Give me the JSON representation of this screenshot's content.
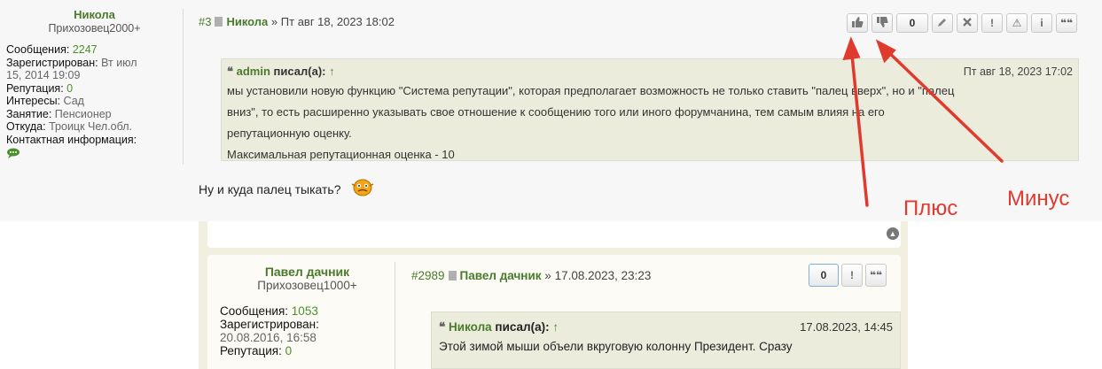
{
  "post1": {
    "profile": {
      "name": "Никола",
      "rank": "Прихозовец2000+",
      "messages_label": "Сообщения:",
      "messages_value": "2247",
      "registered_label": "Зарегистрирован:",
      "registered_value_a": "Вт июл",
      "registered_value_b": "15, 2014 19:09",
      "reputation_label": "Репутация:",
      "reputation_value": "0",
      "interests_label": "Интересы:",
      "interests_value": "Сад",
      "occupation_label": "Занятие:",
      "occupation_value": "Пенсионер",
      "from_label": "Откуда:",
      "from_value": "Троицк Чел.обл.",
      "contact_label": "Контактная информация:"
    },
    "header": {
      "num": "#3",
      "author": "Никола",
      "sep": "»",
      "date": "Пт авг 18, 2023 18:02"
    },
    "toolbar": {
      "like_icon": "thumbs-up-icon",
      "dislike_icon": "thumbs-down-icon",
      "rep_count": "0",
      "edit_icon": "pencil-icon",
      "delete_icon": "x-icon",
      "report_label": "!",
      "warn_label": "⚠",
      "info_label": "i",
      "quote_label": "❝❝"
    },
    "quote": {
      "author": "admin",
      "wrote": "писал(а):",
      "arrow": "↑",
      "date": "Пт авг 18, 2023 17:02",
      "line1": "мы установили новую функцию \"Система репутации\", которая предполагает возможность не только ставить \"палец вверх\", но и \"палец",
      "line2": "вниз\", то есть расширенно указывать свое отношение к сообщению того или иного форумчанина, тем самым влияя на его",
      "line3": "репутационную оценку.",
      "line4": "Максимальная репутационная оценка - 10"
    },
    "message": "Ну и куда палец тыкать?"
  },
  "embed": {
    "profile": {
      "name": "Павел дачник",
      "rank": "Прихозовец1000+",
      "messages_label": "Сообщения:",
      "messages_value": "1053",
      "registered_label": "Зарегистрирован:",
      "registered_value": "20.08.2016, 16:58",
      "reputation_label": "Репутация:",
      "reputation_value": "0"
    },
    "header": {
      "num": "#2989",
      "author": "Павел дачник",
      "sep": "»",
      "date": "17.08.2023, 23:23"
    },
    "toolbar": {
      "rep_count": "0",
      "report_label": "!",
      "quote_label": "❝❝"
    },
    "quote": {
      "author": "Никола",
      "wrote": "писал(а):",
      "arrow": "↑",
      "date": "17.08.2023, 14:45",
      "line1": "Этой зимой мыши объели вкруговую колонну Президент. Сразу"
    }
  },
  "annotations": {
    "plus": "Плюс",
    "minus": "Минус",
    "color": "#e03a2f"
  }
}
